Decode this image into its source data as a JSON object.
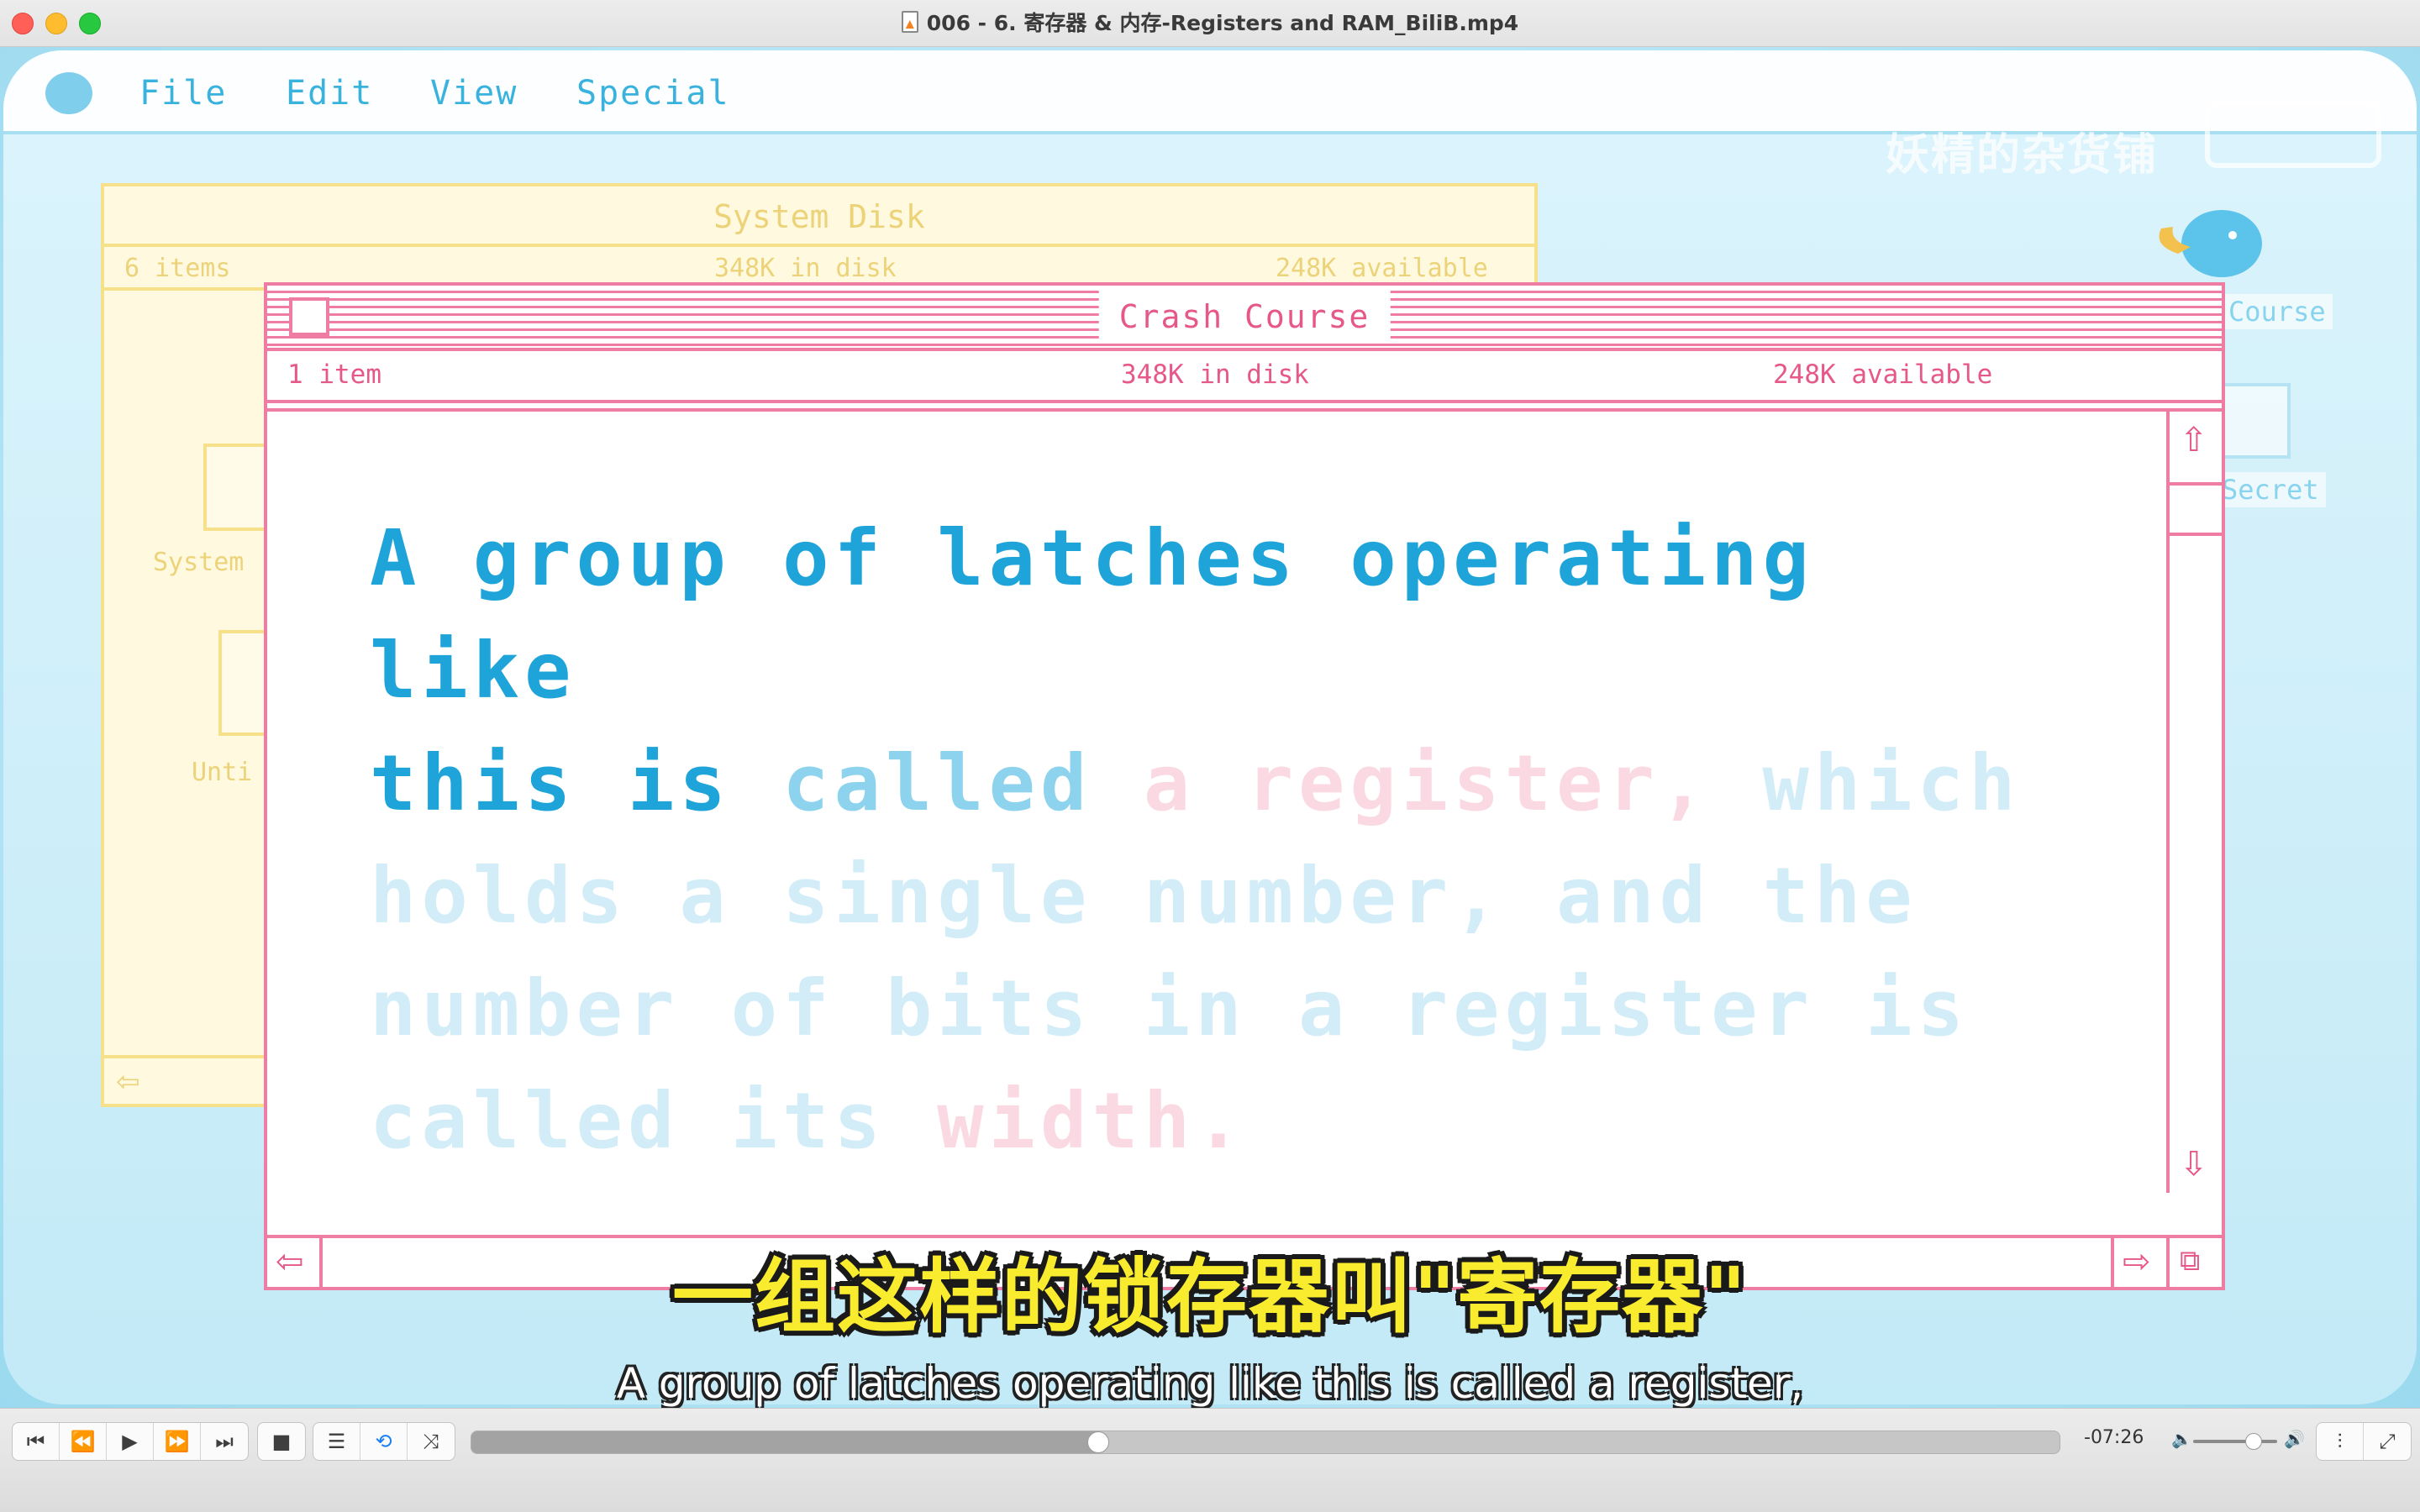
{
  "window": {
    "title": "006 - 6. 寄存器 & 内存-Registers and RAM_BiliB.mp4"
  },
  "video": {
    "menu": [
      "File",
      "Edit",
      "View",
      "Special"
    ],
    "watermark": "妖精的杂货铺",
    "system_disk": {
      "title": "System Disk",
      "items": "6 items",
      "disk": "348K in disk",
      "available": "248K available",
      "icon_labels": [
        "System",
        "Unti"
      ]
    },
    "desktop_labels": [
      "Course",
      "Secret"
    ],
    "crash_course": {
      "title": "Crash Course",
      "items": "1 item",
      "disk": "348K in disk",
      "available": "248K available",
      "text_lines": [
        [
          {
            "t": "A group of latches operating like",
            "s": "strong"
          }
        ],
        [
          {
            "t": "this is ",
            "s": "strong"
          },
          {
            "t": "called ",
            "s": "mid"
          },
          {
            "t": "a register, ",
            "s": "pink"
          },
          {
            "t": "which",
            "s": "faint"
          }
        ],
        [
          {
            "t": "holds a single number, and the",
            "s": "faint"
          }
        ],
        [
          {
            "t": "number of bits in a register is",
            "s": "faint"
          }
        ],
        [
          {
            "t": "called its ",
            "s": "faint"
          },
          {
            "t": "width.",
            "s": "pink"
          }
        ]
      ]
    },
    "subtitle_cn": "一组这样的锁存器叫\"寄存器\"",
    "subtitle_en": "A group of latches operating like this is called a register,"
  },
  "player": {
    "time_remaining": "-07:26",
    "progress_fraction": 0.395,
    "volume_fraction": 0.72,
    "buttons": [
      "skip-back-icon",
      "rewind-icon",
      "play-icon",
      "fast-forward-icon",
      "skip-forward-icon",
      "stop-icon",
      "playlist-icon",
      "loop-icon",
      "shuffle-icon",
      "equalizer-icon",
      "fullscreen-icon"
    ]
  }
}
